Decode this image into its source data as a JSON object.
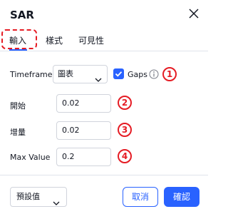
{
  "dialog": {
    "title": "SAR"
  },
  "tabs": [
    {
      "label": "輸入",
      "active": true
    },
    {
      "label": "樣式",
      "active": false
    },
    {
      "label": "可見性",
      "active": false
    }
  ],
  "inputs": {
    "timeframe": {
      "label": "Timeframe",
      "value": "圖表",
      "gaps_label": "Gaps",
      "gaps_checked": true
    },
    "start": {
      "label": "開始",
      "value": "0.02"
    },
    "increment": {
      "label": "增量",
      "value": "0.02"
    },
    "max_value": {
      "label": "Max Value",
      "value": "0.2"
    }
  },
  "annotations": [
    "1",
    "2",
    "3",
    "4"
  ],
  "footer": {
    "defaults_label": "預設值",
    "cancel_label": "取消",
    "ok_label": "確認"
  },
  "colors": {
    "accent": "#2962ff",
    "annotation": "#e51c24",
    "border": "#d1d4dc",
    "text": "#131722"
  },
  "icons": [
    "close-icon",
    "chevron-down-icon",
    "check-icon",
    "info-icon"
  ]
}
